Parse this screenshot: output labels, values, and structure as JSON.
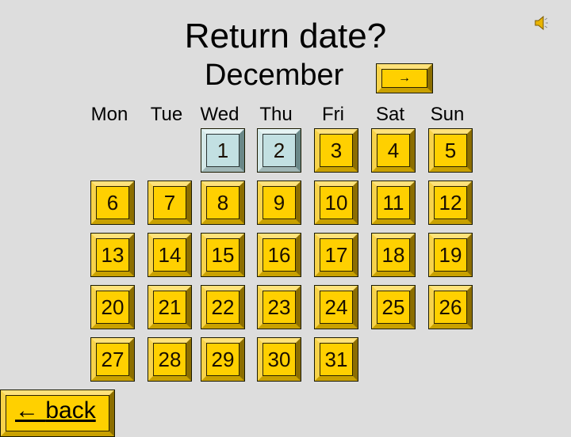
{
  "header": {
    "title": "Return date?",
    "month": "December",
    "next_label": "→",
    "speaker_icon": "speaker-icon"
  },
  "weekdays": [
    "Mon",
    "Tue",
    "Wed",
    "Thu",
    "Fri",
    "Sat",
    "Sun"
  ],
  "calendar": {
    "first_weekday_index": 2,
    "days_in_month": 31,
    "disabled_days": [
      1,
      2
    ],
    "colors": {
      "active_face": "#ffd000",
      "disabled_face": "#c2e0e2",
      "background": "#dddddd"
    }
  },
  "back": {
    "arrow": "←",
    "label": "back"
  }
}
